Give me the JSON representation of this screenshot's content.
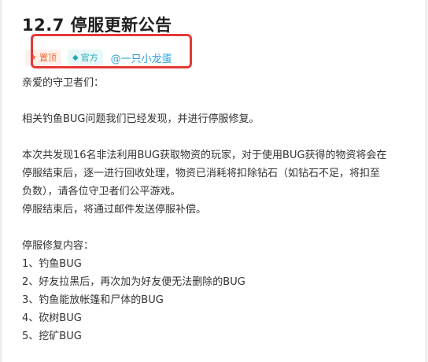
{
  "post": {
    "title": "12.7 停服更新公告",
    "tags": [
      {
        "icon": "star-icon",
        "label": "置顶"
      },
      {
        "icon": "diamond-icon",
        "label": "官方"
      }
    ],
    "author": "@一只小龙蛋",
    "colors": {
      "highlight_border": "#e53935",
      "pin_text": "#f06a34",
      "official_text": "#22a8b5",
      "author_text": "#2a9fd6"
    }
  },
  "body": {
    "greeting": "亲爱的守卫者们：",
    "p1": "相关钓鱼BUG问题我们已经发现，并进行停服修复。",
    "p2_line1": "本次共发现16名非法利用BUG获取物资的玩家，对于使用BUG获得的物资将会在",
    "p2_line2": "停服结束后，逐一进行回收处理，物资已消耗将扣除钻石（如钻石不足，将扣至",
    "p2_line3": "负数），请各位守卫者们公平游戏。",
    "p3": "停服结束后，将通过邮件发送停服补偿。",
    "fix_header": "停服修复内容：",
    "fix_items": [
      "1、钓鱼BUG",
      "2、好友拉黑后，再次加为好友便无法删除的BUG",
      "3、钓鱼能放帐篷和尸体的BUG",
      "4、砍树BUG",
      "5、挖矿BUG"
    ]
  }
}
